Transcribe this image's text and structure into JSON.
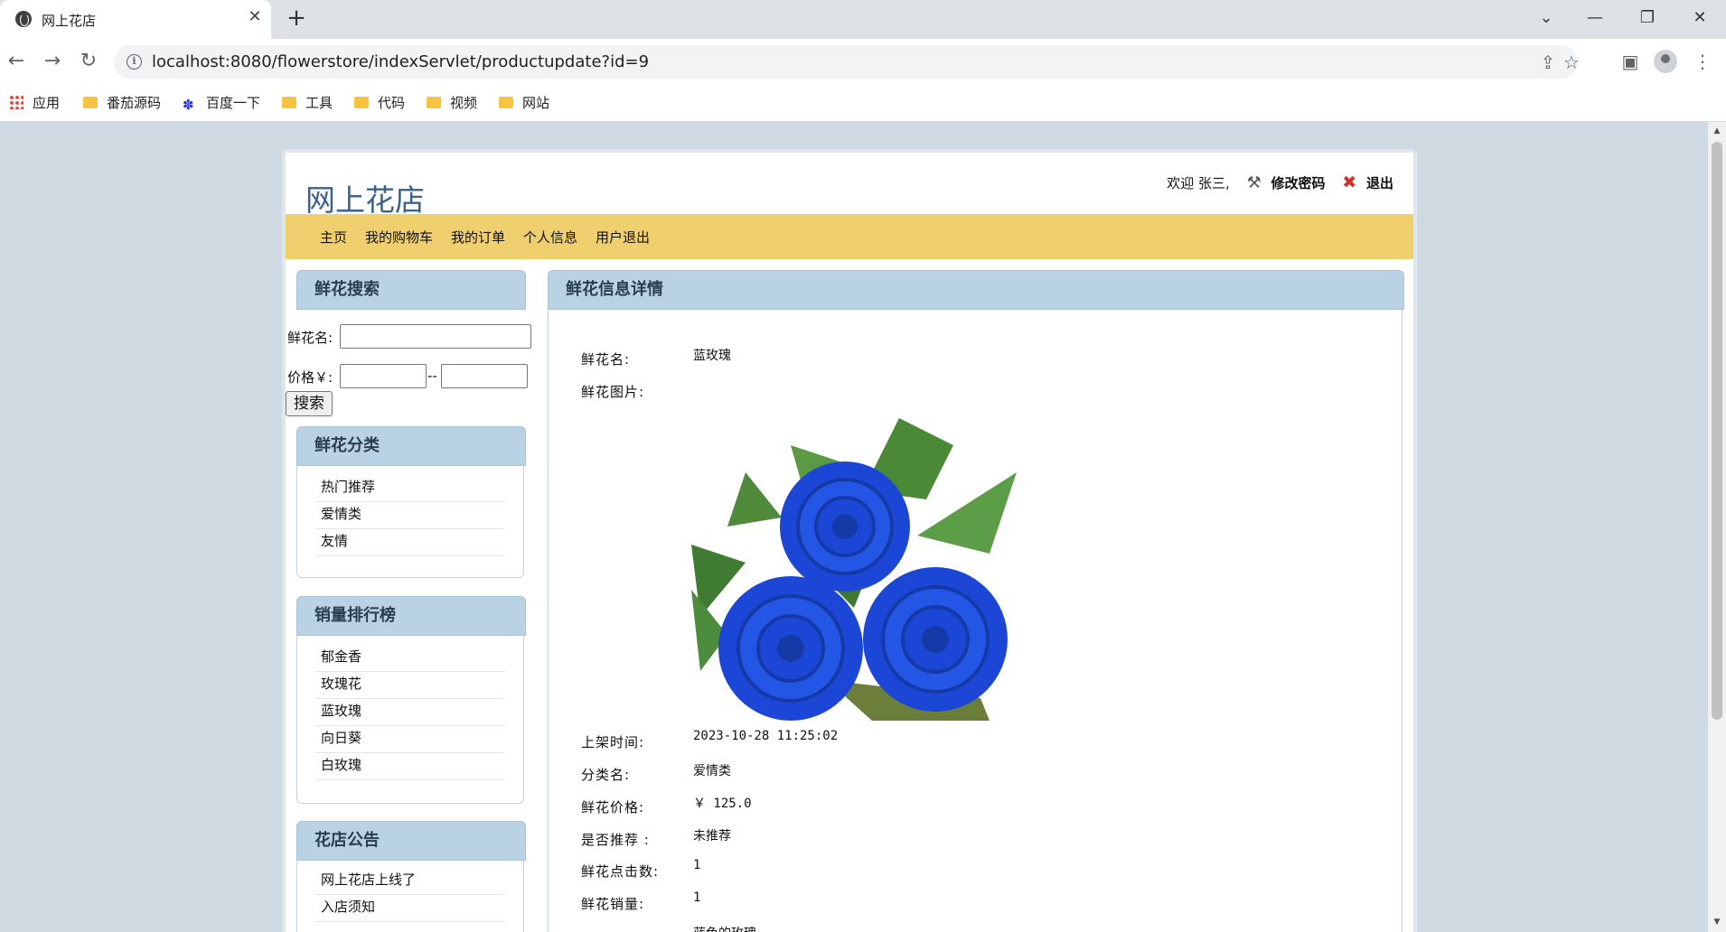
{
  "browser": {
    "tab_title": "网上花店",
    "url": "localhost:8080/flowerstore/indexServlet/productupdate?id=9",
    "bookmarks": [
      "应用",
      "番茄源码",
      "百度一下",
      "工具",
      "代码",
      "视频",
      "网站"
    ]
  },
  "site": {
    "title": "网上花店",
    "welcome": "欢迎 张三,",
    "change_password": "修改密码",
    "logout": "退出",
    "menu": [
      "主页",
      "我的购物车",
      "我的订单",
      "个人信息",
      "用户退出"
    ]
  },
  "search": {
    "heading": "鲜花搜索",
    "name_label": "鲜花名:",
    "name_value": "",
    "price_label": "价格￥:",
    "price_min": "",
    "price_max": "",
    "separator": "--",
    "button": "搜索"
  },
  "categories": {
    "heading": "鲜花分类",
    "items": [
      "热门推荐",
      "爱情类",
      "友情"
    ]
  },
  "ranking": {
    "heading": "销量排行榜",
    "items": [
      "郁金香",
      "玫瑰花",
      "蓝玫瑰",
      "向日葵",
      "白玫瑰"
    ]
  },
  "notice": {
    "heading": "花店公告",
    "items": [
      "网上花店上线了",
      "入店须知"
    ]
  },
  "detail": {
    "heading": "鲜花信息详情",
    "fields": [
      {
        "label": "鲜花名:",
        "value": "蓝玫瑰"
      },
      {
        "label": "鲜花图片:",
        "value": ""
      },
      {
        "label": "上架时间:",
        "value": "2023-10-28 11:25:02"
      },
      {
        "label": "分类名:",
        "value": "爱情类"
      },
      {
        "label": "鲜花价格:",
        "value": "￥ 125.0"
      },
      {
        "label": "是否推荐 :",
        "value": "未推荐"
      },
      {
        "label": "鲜花点击数:",
        "value": "1"
      },
      {
        "label": "鲜花销量:",
        "value": "1"
      },
      {
        "label": "",
        "value": "蓝色的玫瑰"
      }
    ]
  },
  "colors": {
    "menubar": "#efcf6e",
    "panel_header": "#b9d3e5",
    "site_title": "#3b6288",
    "page_background": "#cfd9e1"
  }
}
